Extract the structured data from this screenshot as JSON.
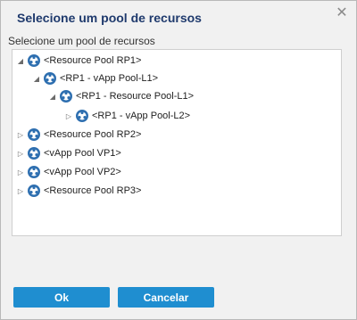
{
  "dialog": {
    "title": "Selecione um pool de recursos",
    "close_icon": "close-icon",
    "subtitle": "Selecione um pool de recursos"
  },
  "tree": {
    "nodes": [
      {
        "label": "<Resource Pool RP1>",
        "expanded": true,
        "icon": "resource-pool-icon"
      },
      {
        "label": "<RP1 - vApp Pool-L1>",
        "expanded": true,
        "icon": "resource-pool-icon"
      },
      {
        "label": "<RP1 - Resource Pool-L1>",
        "expanded": true,
        "icon": "resource-pool-icon"
      },
      {
        "label": "<RP1 - vApp Pool-L2>",
        "expanded": false,
        "icon": "resource-pool-icon"
      },
      {
        "label": "<Resource Pool RP2>",
        "expanded": false,
        "icon": "resource-pool-icon"
      },
      {
        "label": "<vApp Pool VP1>",
        "expanded": false,
        "icon": "resource-pool-icon"
      },
      {
        "label": "<vApp Pool VP2>",
        "expanded": false,
        "icon": "resource-pool-icon"
      },
      {
        "label": "<Resource Pool RP3>",
        "expanded": false,
        "icon": "resource-pool-icon"
      }
    ]
  },
  "buttons": {
    "ok": "Ok",
    "cancel": "Cancelar"
  },
  "colors": {
    "title": "#1f3a6d",
    "button": "#1f8ed0",
    "icon": "#2e6fb0"
  }
}
